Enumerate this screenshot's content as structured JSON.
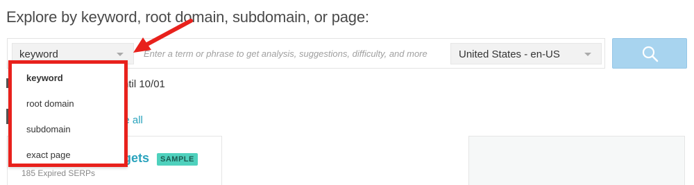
{
  "heading": "Explore by keyword, root domain, subdomain, or page:",
  "search": {
    "type_selected": "keyword",
    "placeholder": "Enter a term or phrase to get analysis, suggestions, difficulty, and more",
    "locale_selected": "United States - en-US",
    "button_icon": "search-icon"
  },
  "dropdown": {
    "items": [
      "keyword",
      "root domain",
      "subdomain",
      "exact page"
    ],
    "selected_index": 0
  },
  "background": {
    "until_text": "ntil 10/01",
    "see_all": "ee all",
    "card_title": "gets",
    "badge": "SAMPLE",
    "card_subtext": "185 Expired SERPs"
  },
  "annotation": {
    "highlight_color": "#e8211c"
  }
}
